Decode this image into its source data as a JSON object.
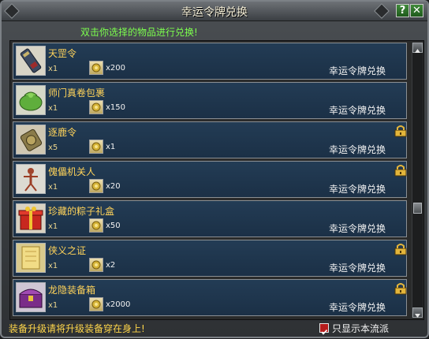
{
  "window": {
    "title": "幸运令牌兑换",
    "help_label": "?",
    "close_label": "✕"
  },
  "instruction": "双击你选择的物品进行兑换!",
  "exchange_label": "幸运令牌兑换",
  "items": [
    {
      "name": "天罡令",
      "qty": "x1",
      "cost": "x200",
      "icon": "tablet-icon",
      "locked": false
    },
    {
      "name": "师门真卷包裹",
      "qty": "x1",
      "cost": "x150",
      "icon": "bundle-icon",
      "locked": false
    },
    {
      "name": "逐鹿令",
      "qty": "x5",
      "cost": "x1",
      "icon": "token-icon",
      "locked": true
    },
    {
      "name": "傀儡机关人",
      "qty": "x1",
      "cost": "x20",
      "icon": "puppet-icon",
      "locked": true
    },
    {
      "name": "珍藏的粽子礼盒",
      "qty": "x1",
      "cost": "x50",
      "icon": "giftbox-icon",
      "locked": false
    },
    {
      "name": "侠义之证",
      "qty": "x1",
      "cost": "x2",
      "icon": "scroll-icon",
      "locked": true
    },
    {
      "name": "龙隐装备箱",
      "qty": "x1",
      "cost": "x2000",
      "icon": "chest-icon",
      "locked": true
    }
  ],
  "footer": {
    "tip": "装备升级请将升级装备穿在身上!",
    "filter_label": "只显示本流派",
    "filter_checked": true
  }
}
